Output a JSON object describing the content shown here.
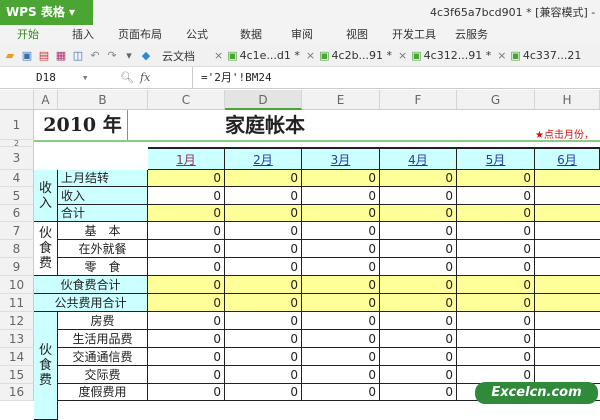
{
  "app": {
    "name": "WPS 表格",
    "doc_title": "4c3f65a7bcd901 * [兼容模式] -"
  },
  "menu": [
    "开始",
    "插入",
    "页面布局",
    "公式",
    "数据",
    "审阅",
    "视图",
    "开发工具",
    "云服务"
  ],
  "toolbar": {
    "cloud_docs": "云文档",
    "tabs": [
      "4c1e...d1 *",
      "4c2b...91 *",
      "4c312...91 *",
      "4c337...21"
    ]
  },
  "formula_bar": {
    "cell_ref": "D18",
    "fx": "fx",
    "formula": "='2月'!BM24"
  },
  "columns": [
    "A",
    "B",
    "C",
    "D",
    "E",
    "F",
    "G",
    "H"
  ],
  "sheet": {
    "year": "2010 年",
    "title": "家庭帐本",
    "hint": "★点击月份，",
    "months": [
      "1月",
      "2月",
      "3月",
      "4月",
      "5月",
      "6月"
    ],
    "groups": {
      "income": "收\n入",
      "food": "伙\n食\n费",
      "food2": "伙\n食\n费"
    },
    "rows": [
      {
        "num": "1"
      },
      {
        "num": "2"
      },
      {
        "num": "3"
      },
      {
        "num": "4",
        "label": "上月结转",
        "values": [
          0,
          0,
          0,
          0,
          0
        ]
      },
      {
        "num": "5",
        "label": "收入",
        "values": [
          0,
          0,
          0,
          0,
          0
        ]
      },
      {
        "num": "6",
        "label": "合计",
        "values": [
          0,
          0,
          0,
          0,
          0
        ]
      },
      {
        "num": "7",
        "label": "基　本",
        "values": [
          0,
          0,
          0,
          0,
          0
        ]
      },
      {
        "num": "8",
        "label": "在外就餐",
        "values": [
          0,
          0,
          0,
          0,
          0
        ]
      },
      {
        "num": "9",
        "label": "零　食",
        "values": [
          0,
          0,
          0,
          0,
          0
        ]
      },
      {
        "num": "10",
        "label": "伙食费合计",
        "values": [
          0,
          0,
          0,
          0,
          0
        ]
      },
      {
        "num": "11",
        "label": "公共费用合计",
        "values": [
          0,
          0,
          0,
          0,
          0
        ]
      },
      {
        "num": "12",
        "label": "房费",
        "values": [
          0,
          0,
          0,
          0,
          0
        ]
      },
      {
        "num": "13",
        "label": "生活用品费",
        "values": [
          0,
          0,
          0,
          0,
          0
        ]
      },
      {
        "num": "14",
        "label": "交通通信费",
        "values": [
          0,
          0,
          0,
          0,
          0
        ]
      },
      {
        "num": "15",
        "label": "交际费",
        "values": [
          0,
          0,
          0,
          0,
          0
        ]
      },
      {
        "num": "16",
        "label": "度假费用",
        "values": [
          0,
          0,
          0,
          0,
          0
        ]
      }
    ]
  },
  "watermark": "Excelcn.com"
}
